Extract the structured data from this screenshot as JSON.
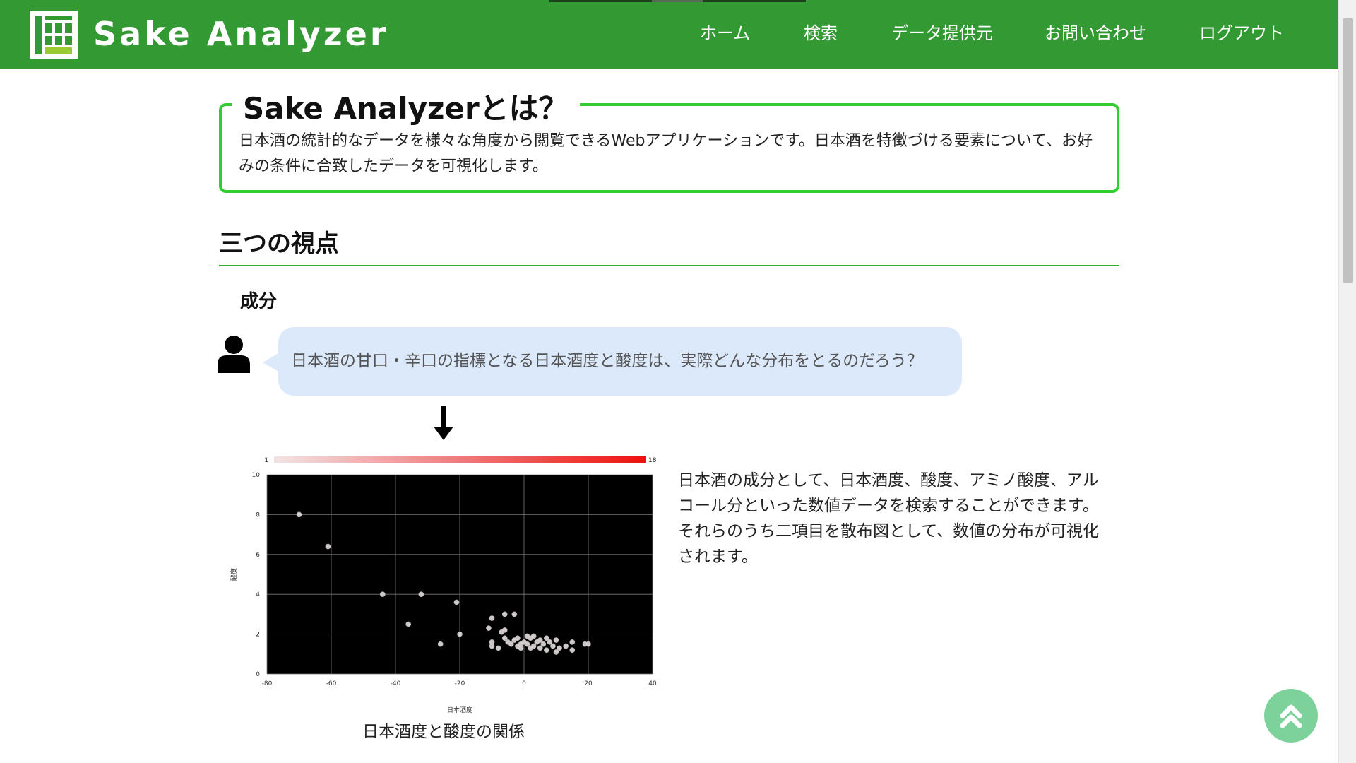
{
  "header": {
    "app_name": "Sake Analyzer",
    "nav": [
      {
        "label": "ホーム"
      },
      {
        "label": "検索"
      },
      {
        "label": "データ提供元"
      },
      {
        "label": "お問い合わせ"
      },
      {
        "label": "ログアウト"
      }
    ],
    "colors": {
      "background": "#339933",
      "logo_accent": "#99cc33"
    }
  },
  "about": {
    "title": "Sake Analyzerとは？",
    "text": "日本酒の統計的なデータを様々な角度から閲覧できるWebアプリケーションです。日本酒を特徴づける要素について、お好みの条件に合致したデータを可視化します。"
  },
  "section": {
    "heading": "三つの視点",
    "subheading": "成分",
    "question": "日本酒の甘口・辛口の指標となる日本酒度と酸度は、実際どんな分布をとるのだろう？",
    "chart_caption": "日本酒度と酸度の関係",
    "description": "日本酒の成分として、日本酒度、酸度、アミノ酸度、アルコール分といった数値データを検索することができます。それらのうち二項目を散布図として、数値の分布が可視化されます。"
  },
  "chart_data": {
    "type": "scatter",
    "title": "",
    "xlabel": "日本酒度",
    "ylabel": "酸度",
    "xlim": [
      -80,
      40
    ],
    "ylim": [
      0,
      10
    ],
    "x_ticks": [
      -80,
      -60,
      -40,
      -20,
      0,
      20,
      40
    ],
    "y_ticks": [
      0,
      2,
      4,
      6,
      8,
      10
    ],
    "grid": true,
    "background": "#000000",
    "colorscale": {
      "min": 1,
      "max": 18,
      "min_color": "#f2e4e4",
      "max_color": "#ee1111",
      "min_label": "1",
      "max_label": "18"
    },
    "points": [
      {
        "x": -70,
        "y": 8.0
      },
      {
        "x": -61,
        "y": 6.4
      },
      {
        "x": -44,
        "y": 4.0
      },
      {
        "x": -32,
        "y": 4.0
      },
      {
        "x": -36,
        "y": 2.5
      },
      {
        "x": -21,
        "y": 3.6
      },
      {
        "x": -26,
        "y": 1.5
      },
      {
        "x": -20,
        "y": 2.0
      },
      {
        "x": -11,
        "y": 2.3
      },
      {
        "x": -10,
        "y": 2.8
      },
      {
        "x": -6,
        "y": 3.0
      },
      {
        "x": -3,
        "y": 3.0
      },
      {
        "x": -7,
        "y": 2.1
      },
      {
        "x": -6,
        "y": 2.2
      },
      {
        "x": -10,
        "y": 1.6
      },
      {
        "x": -10,
        "y": 1.4
      },
      {
        "x": -8,
        "y": 1.3
      },
      {
        "x": -6,
        "y": 1.8
      },
      {
        "x": -5,
        "y": 1.6
      },
      {
        "x": -4,
        "y": 1.5
      },
      {
        "x": -3,
        "y": 1.7
      },
      {
        "x": -2,
        "y": 1.4
      },
      {
        "x": -1,
        "y": 1.3
      },
      {
        "x": 0,
        "y": 1.6
      },
      {
        "x": 1,
        "y": 1.5
      },
      {
        "x": 2,
        "y": 1.8
      },
      {
        "x": 3,
        "y": 1.4
      },
      {
        "x": 3,
        "y": 1.9
      },
      {
        "x": 4,
        "y": 1.6
      },
      {
        "x": 5,
        "y": 1.3
      },
      {
        "x": 5,
        "y": 1.7
      },
      {
        "x": 6,
        "y": 1.5
      },
      {
        "x": 7,
        "y": 1.8
      },
      {
        "x": 7,
        "y": 1.2
      },
      {
        "x": 8,
        "y": 1.6
      },
      {
        "x": 9,
        "y": 1.4
      },
      {
        "x": 10,
        "y": 1.1
      },
      {
        "x": 10,
        "y": 1.7
      },
      {
        "x": 11,
        "y": 1.3
      },
      {
        "x": 13,
        "y": 1.4
      },
      {
        "x": 15,
        "y": 1.6
      },
      {
        "x": 15,
        "y": 1.2
      },
      {
        "x": 19,
        "y": 1.5
      },
      {
        "x": 20,
        "y": 1.5
      },
      {
        "x": -1,
        "y": 1.5
      },
      {
        "x": 1,
        "y": 1.9
      },
      {
        "x": 2,
        "y": 1.3
      },
      {
        "x": -2,
        "y": 1.8
      }
    ]
  }
}
